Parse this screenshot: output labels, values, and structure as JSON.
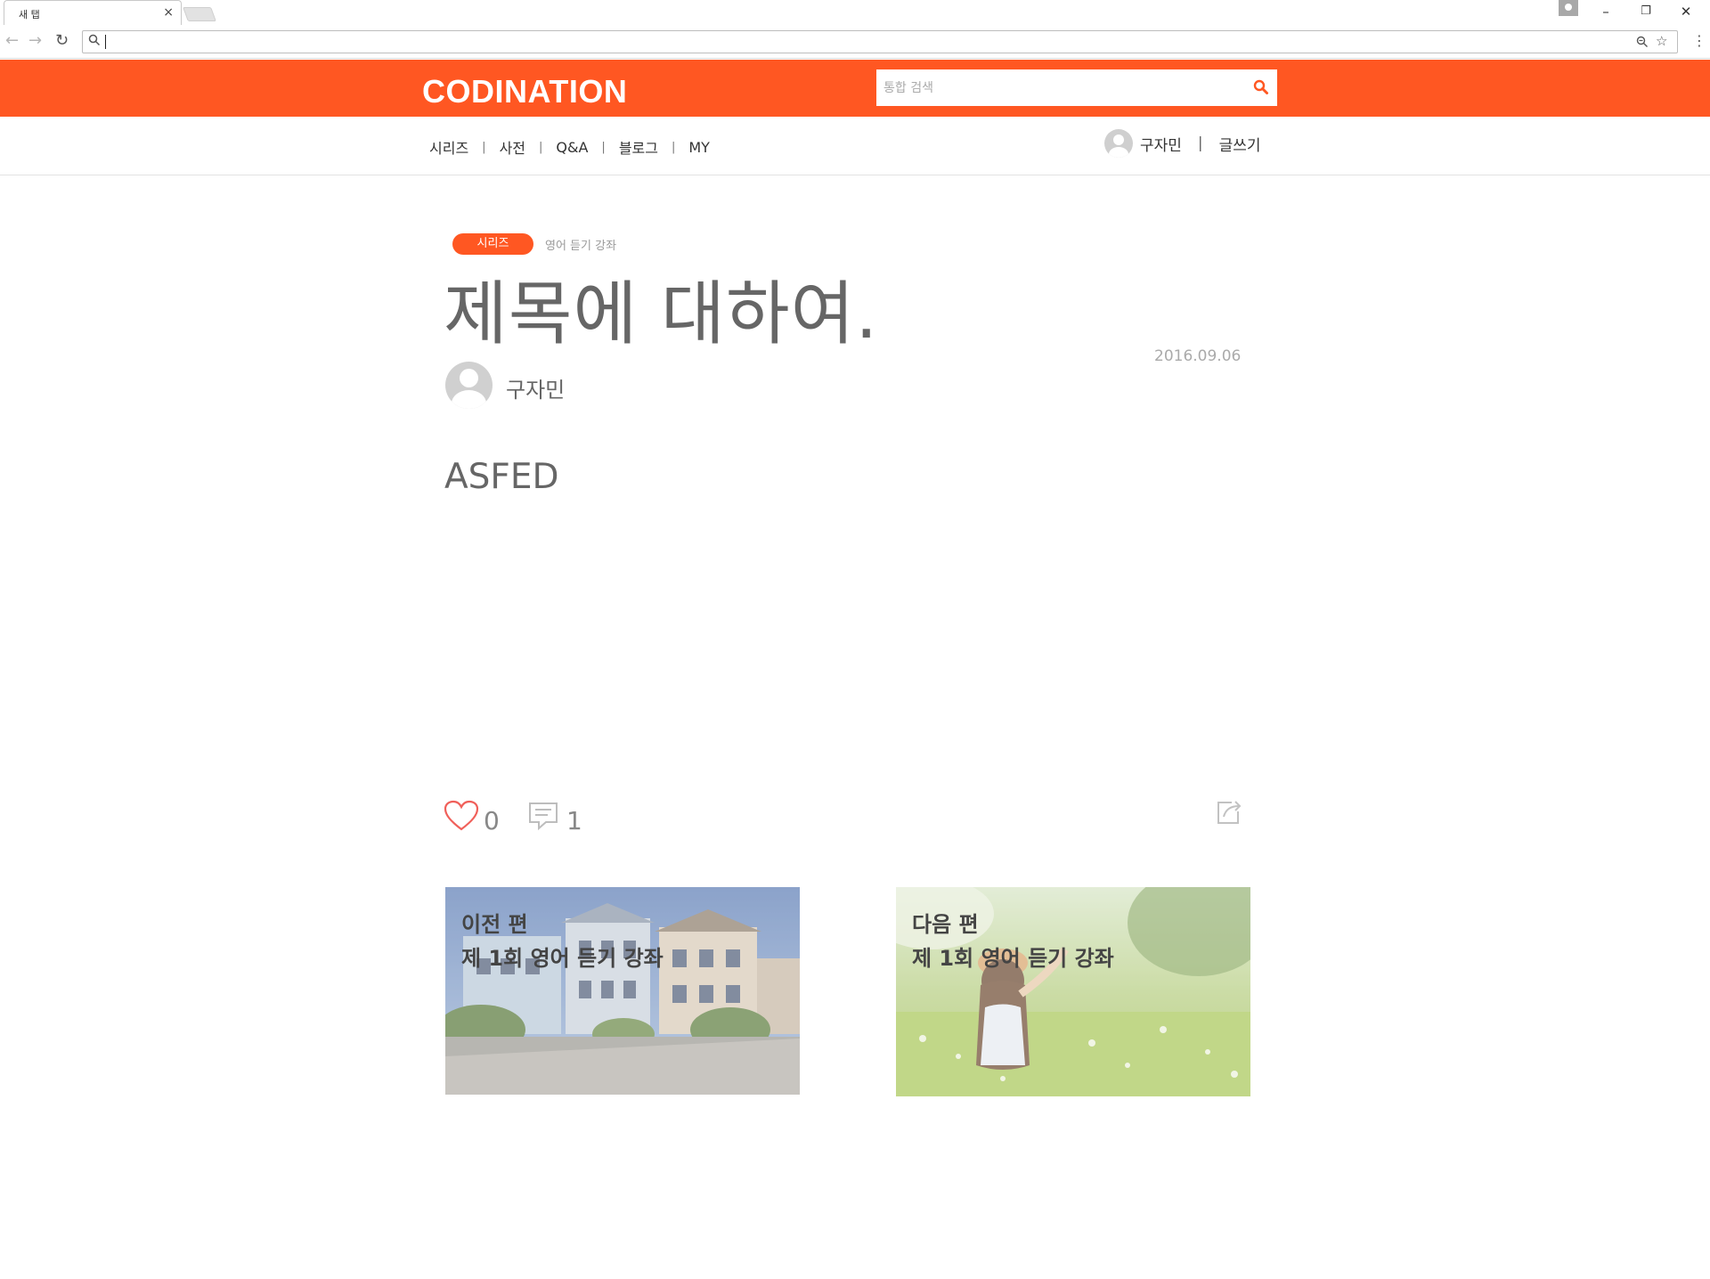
{
  "browser": {
    "tab_title": "새 탭",
    "tab_close": "×",
    "window_controls": {
      "minimize": "–",
      "restore": "❐",
      "close": "✕"
    }
  },
  "header": {
    "logo": "CODINATION",
    "search_placeholder": "통합 검색",
    "brand_color": "#ff5722"
  },
  "subnav": {
    "menu": [
      "시리즈",
      "사전",
      "Q&A",
      "블로그",
      "MY"
    ],
    "separator": "|",
    "user_name": "구자민",
    "write_label": "글쓰기"
  },
  "post": {
    "category_badge": "시리즈",
    "series_name": "영어 듣기 강좌",
    "title": "제목에 대하여.",
    "date": "2016.09.06",
    "author": "구자민",
    "body": "ASFED",
    "likes": "0",
    "comments": "1"
  },
  "navigation": {
    "prev": {
      "kicker": "이전 편",
      "title": "제 1회 영어 듣기 강좌"
    },
    "next": {
      "kicker": "다음 편",
      "title": "제 1회 영어 듣기 강좌"
    }
  }
}
